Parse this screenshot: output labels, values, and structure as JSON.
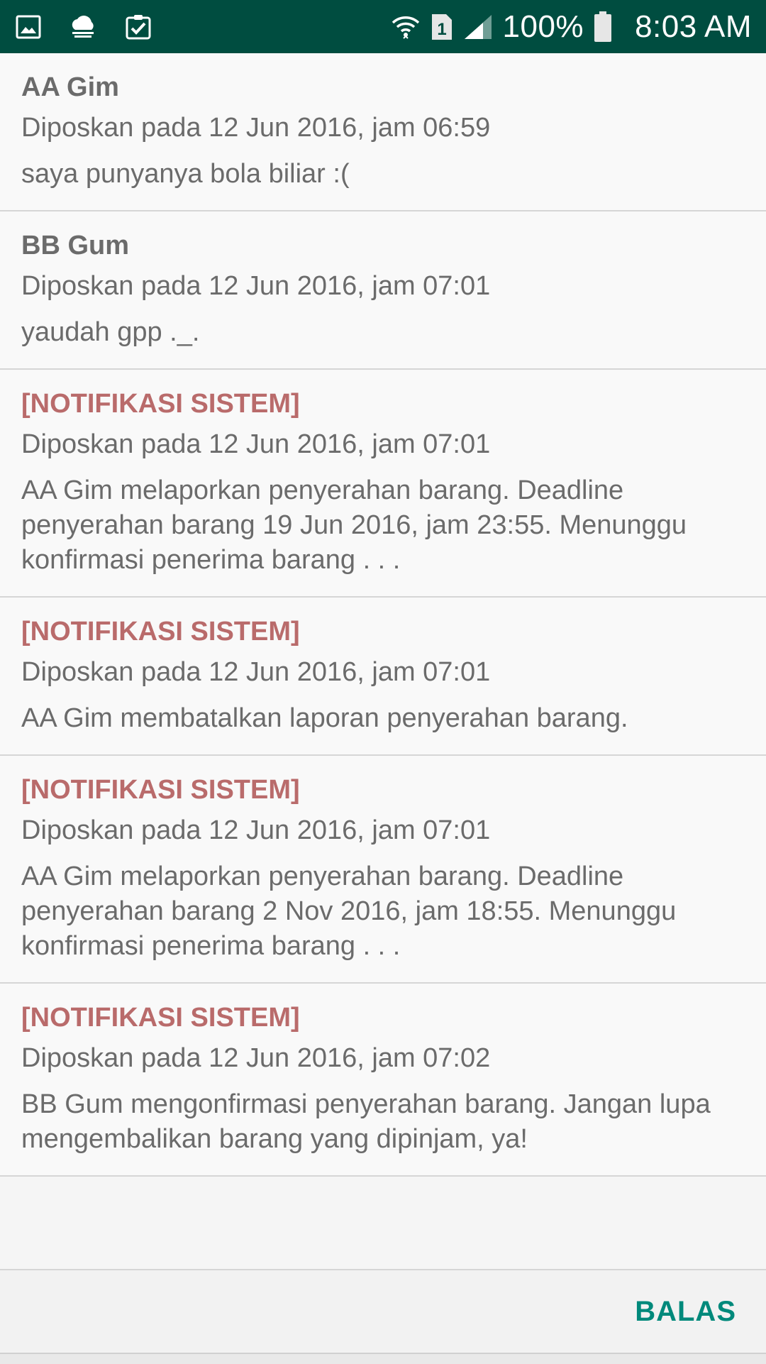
{
  "status_bar": {
    "battery": "100%",
    "time": "8:03 AM",
    "bg_color": "#004d40",
    "left_icons": [
      "gallery-icon",
      "cloud-icon",
      "clipboard-check-icon"
    ],
    "right_icons": [
      "wifi-icon",
      "sim-1-icon",
      "signal-icon",
      "battery-icon"
    ]
  },
  "messages": [
    {
      "author": "AA Gim",
      "timestamp": "Diposkan pada 12 Jun 2016, jam 06:59",
      "text": "saya punyanya bola biliar :(",
      "system": false
    },
    {
      "author": "BB Gum",
      "timestamp": "Diposkan pada 12 Jun 2016, jam 07:01",
      "text": "yaudah gpp ._.",
      "system": false
    },
    {
      "author": "[NOTIFIKASI SISTEM]",
      "timestamp": "Diposkan pada 12 Jun 2016, jam 07:01",
      "text": "AA Gim melaporkan penyerahan barang. Deadline penyerahan barang 19 Jun 2016, jam 23:55. Menunggu konfirmasi penerima barang . . .",
      "system": true
    },
    {
      "author": "[NOTIFIKASI SISTEM]",
      "timestamp": "Diposkan pada 12 Jun 2016, jam 07:01",
      "text": "AA Gim membatalkan laporan penyerahan barang.",
      "system": true
    },
    {
      "author": "[NOTIFIKASI SISTEM]",
      "timestamp": "Diposkan pada 12 Jun 2016, jam 07:01",
      "text": "AA Gim melaporkan penyerahan barang. Deadline penyerahan barang 2 Nov 2016, jam 18:55. Menunggu konfirmasi penerima barang . . .",
      "system": true
    },
    {
      "author": "[NOTIFIKASI SISTEM]",
      "timestamp": "Diposkan pada 12 Jun 2016, jam 07:02",
      "text": "BB Gum mengonfirmasi penyerahan barang. Jangan lupa mengembalikan barang yang dipinjam, ya!",
      "system": true
    }
  ],
  "footer": {
    "reply_label": "BALAS",
    "accent_color": "#00897b"
  },
  "colors": {
    "system_author": "#b96b6b",
    "text": "#6b6b6b"
  }
}
